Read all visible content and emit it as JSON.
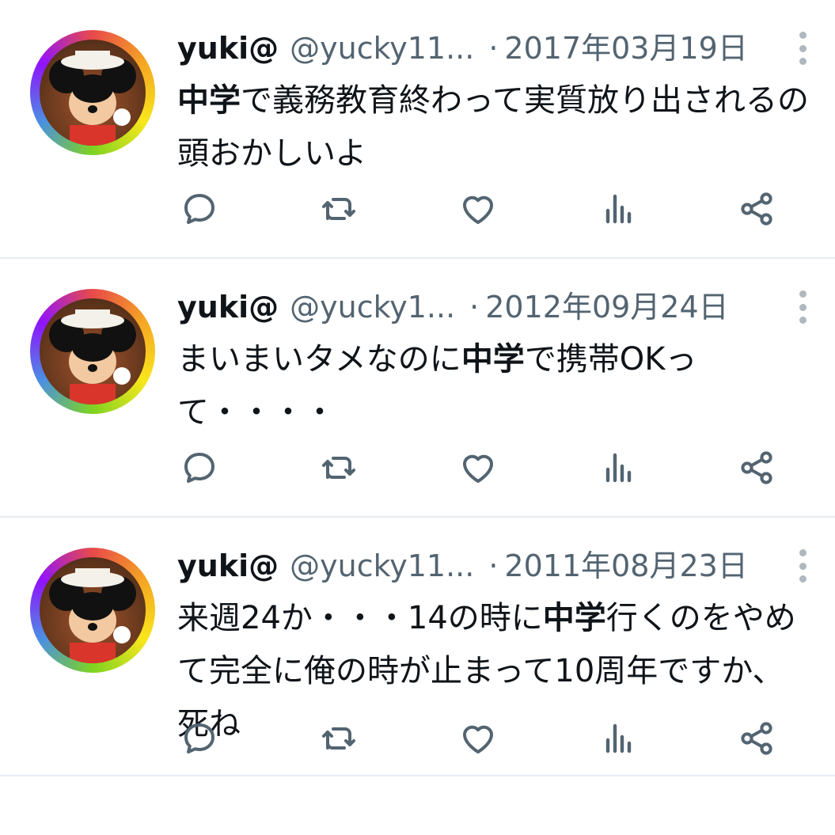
{
  "tweets": [
    {
      "name": "yuki@",
      "handle": "@yucky11...",
      "sep": "·",
      "date": "2017年03月19日",
      "text_bold": "中学",
      "text_rest": "で義務教育終わって実質放り出されるの頭おかしいよ"
    },
    {
      "name": "yuki@",
      "handle": "@yucky1...",
      "sep": "·",
      "date": "2012年09月24日",
      "text_before": "まいまいタメなのに",
      "text_bold": "中学",
      "text_rest": "で携帯OKって・・・・"
    },
    {
      "name": "yuki@",
      "handle": "@yucky11...",
      "sep": "·",
      "date": "2011年08月23日",
      "text_before": "来週24か・・・14の時に",
      "text_bold": "中学",
      "text_rest": "行くのをやめて完全に俺の時が止まって10周年ですか、死ね"
    }
  ],
  "icons": {
    "reply": "reply-icon",
    "retweet": "retweet-icon",
    "like": "heart-icon",
    "views": "views-icon",
    "share": "share-icon",
    "more": "more-vertical-icon"
  },
  "colors": {
    "text": "#0f1419",
    "secondary": "#536471",
    "divider": "#e6ecf0"
  }
}
